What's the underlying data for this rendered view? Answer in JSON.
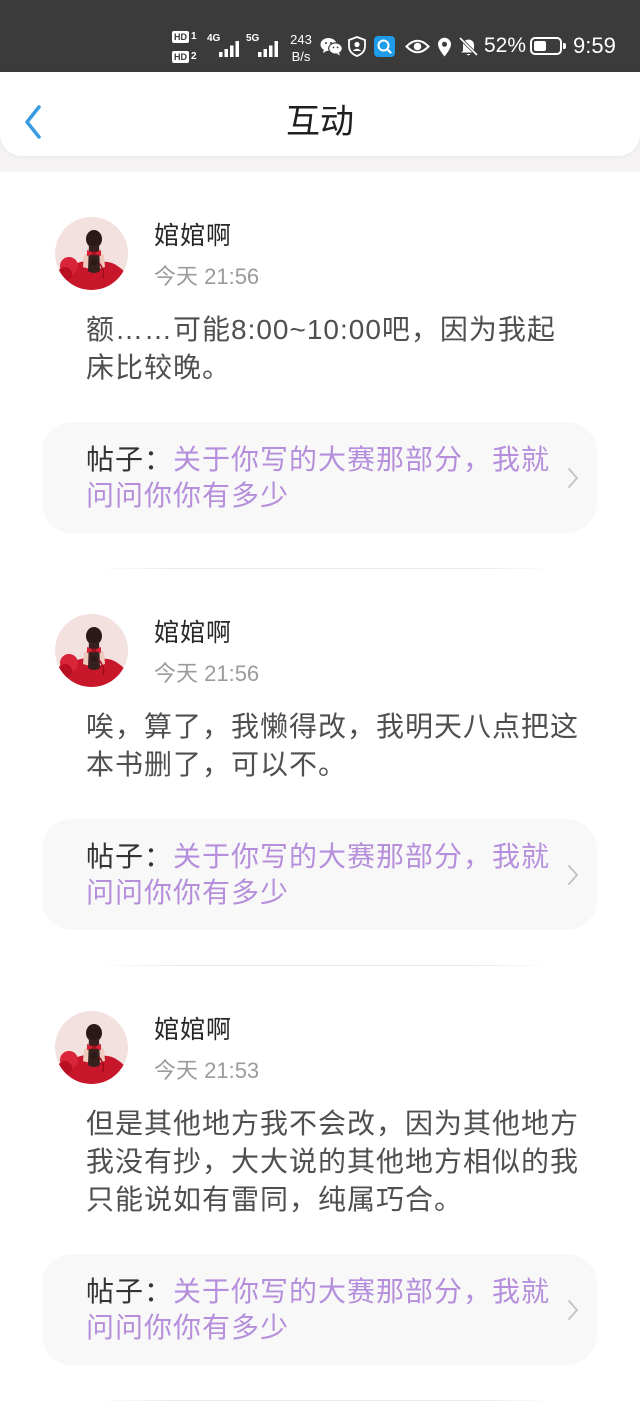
{
  "status_bar": {
    "sim1_badge": "HD",
    "sim1_number": "1",
    "sim2_badge": "HD",
    "sim2_number": "2",
    "network_1": "4G",
    "network_2": "5G",
    "net_speed_value": "243",
    "net_speed_unit": "B/s",
    "icons": [
      "signal-icon",
      "wechat-icon",
      "shield-icon",
      "search-app-icon",
      "eye-icon",
      "location-icon",
      "bell-off-icon",
      "battery-icon"
    ],
    "battery_text": "52%",
    "battery_level": 0.52,
    "time": "9:59"
  },
  "header": {
    "back_icon": "chevron-left-icon",
    "title": "互动"
  },
  "colors": {
    "status_bar_bg": "#3b3b3b",
    "accent": "#3a9be0",
    "post_title": "#b58fdb",
    "search_app": "#1e9cea",
    "comment_text": "#4f4f4f",
    "time_text": "#9b9b9b"
  },
  "comments": [
    {
      "user_name": "婠婠啊",
      "time": "今天 21:56",
      "text": "额……可能8:00~10:00吧，因为我起床比较晚。",
      "post_label": "帖子：",
      "post_title": "关于你写的大赛那部分，我就问问你你有多少"
    },
    {
      "user_name": "婠婠啊",
      "time": "今天 21:56",
      "text": "唉，算了，我懒得改，我明天八点把这本书删了，可以不。",
      "post_label": "帖子：",
      "post_title": "关于你写的大赛那部分，我就问问你你有多少"
    },
    {
      "user_name": "婠婠啊",
      "time": "今天 21:53",
      "text": "但是其他地方我不会改，因为其他地方我没有抄，大大说的其他地方相似的我只能说如有雷同，纯属巧合。",
      "post_label": "帖子：",
      "post_title": "关于你写的大赛那部分，我就问问你你有多少"
    }
  ]
}
